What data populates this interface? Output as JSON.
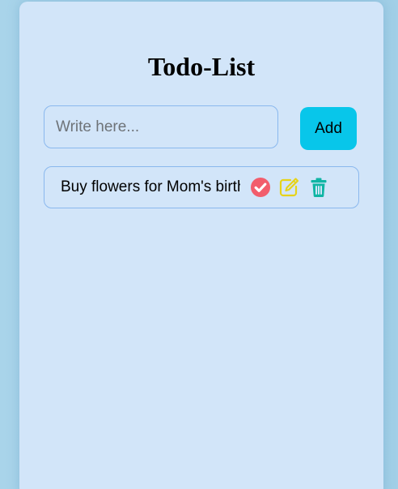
{
  "app": {
    "title": "Todo-List"
  },
  "input": {
    "placeholder": "Write here...",
    "value": ""
  },
  "add_button": {
    "label": "Add"
  },
  "todos": [
    {
      "text": "Buy flowers for Mom's birthday",
      "actions": {
        "complete_icon": "check-circle-icon",
        "edit_icon": "pencil-square-icon",
        "delete_icon": "trash-icon"
      }
    }
  ],
  "colors": {
    "card_background": "#d2e5f9",
    "add_button": "#08c6ea",
    "complete_icon": "#f25d6c",
    "edit_icon": "#e6d31a",
    "delete_icon": "#10b5a4",
    "border": "#8ab8ee"
  }
}
